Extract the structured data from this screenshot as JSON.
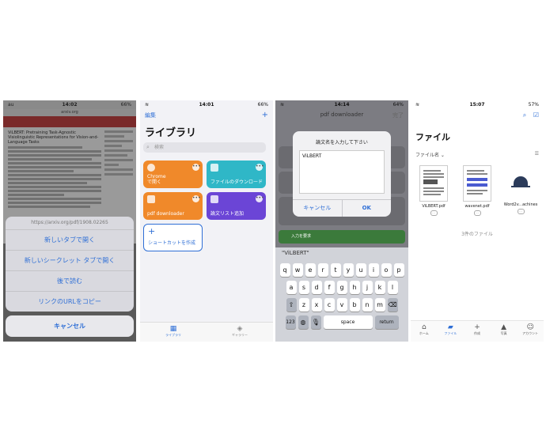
{
  "phone1": {
    "status": {
      "carrier": "au",
      "time": "14:02",
      "battery": "66%"
    },
    "browser_url": "arxiv.org",
    "paper_title": "ViLBERT: Pretraining Task-Agnostic Visiolinguistic Representations for Vision-and-Language Tasks",
    "sheet_header": "https://arxiv.org/pdf/1908.02265",
    "actions": [
      "新しいタブで開く",
      "新しいシークレット タブで開く",
      "後で読む",
      "リンクのURLをコピー"
    ],
    "cancel": "キャンセル"
  },
  "phone2": {
    "status": {
      "time": "14:01",
      "battery": "66%"
    },
    "edit": "編集",
    "add": "+",
    "title": "ライブラリ",
    "search_placeholder": "検索",
    "shortcuts": [
      {
        "label": "Chrome\nで開く",
        "color": "#f0892a"
      },
      {
        "label": "ファイルのダウンロード",
        "color": "#2fb7c7"
      },
      {
        "label": "pdf downloader",
        "color": "#f0892a"
      },
      {
        "label": "論文リスト追加",
        "color": "#6b45d6"
      }
    ],
    "create_shortcut": "ショートカットを作成",
    "tabs": [
      "ライブラリ",
      "ギャラリー"
    ]
  },
  "phone3": {
    "status": {
      "time": "14:14",
      "battery": "64%"
    },
    "title": "pdf downloader",
    "done": "完了",
    "dialog_title": "論文名を入力して下さい",
    "dialog_value": "ViLBERT",
    "dialog_cancel": "キャンセル",
    "dialog_ok": "OK",
    "input_action": "入力を要求",
    "suggestion": "\"ViLBERT\"",
    "keys_row1": [
      "q",
      "w",
      "e",
      "r",
      "t",
      "y",
      "u",
      "i",
      "o",
      "p"
    ],
    "keys_row2": [
      "a",
      "s",
      "d",
      "f",
      "g",
      "h",
      "j",
      "k",
      "l"
    ],
    "keys_row3": [
      "z",
      "x",
      "c",
      "v",
      "b",
      "n",
      "m"
    ],
    "key_123": "123",
    "key_space": "space",
    "key_return": "return"
  },
  "phone4": {
    "status": {
      "time": "15:07",
      "battery": "57%"
    },
    "title": "ファイル",
    "sort": "ファイル名 ⌄",
    "files": [
      {
        "name": "ViLBERT.pdf"
      },
      {
        "name": "wavenet.pdf"
      },
      {
        "name": "Word2v...achines"
      }
    ],
    "count": "3件のファイル",
    "tabs": [
      "ホーム",
      "ファイル",
      "作成",
      "写真",
      "アカウント"
    ]
  }
}
